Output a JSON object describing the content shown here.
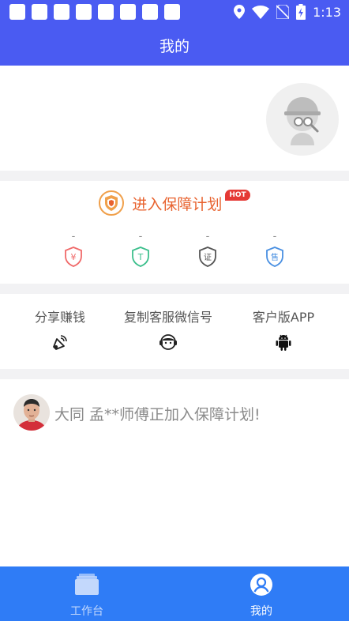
{
  "status_bar": {
    "notification_icons": [
      "notification-icon",
      "notification-icon",
      "notification-icon",
      "notification-icon",
      "notification-icon",
      "notification-icon",
      "notification-icon",
      "notification-icon"
    ],
    "system_icons": [
      "location-icon",
      "wifi-icon",
      "no-sim-icon",
      "battery-charging-icon"
    ],
    "time": "1:13"
  },
  "header": {
    "title": "我的"
  },
  "guarantee": {
    "label": "进入保障计划",
    "hot_badge": "HOT",
    "badges": [
      {
        "value": "-",
        "glyph": "¥",
        "color": "#f06a6a",
        "icon": "yuan-shield-icon"
      },
      {
        "value": "-",
        "glyph": "T",
        "color": "#3cbf8c",
        "icon": "tenge-shield-icon"
      },
      {
        "value": "-",
        "glyph": "证",
        "color": "#555555",
        "icon": "certificate-shield-icon"
      },
      {
        "value": "-",
        "glyph": "售",
        "color": "#4a90e2",
        "icon": "after-sales-shield-icon"
      }
    ]
  },
  "actions": [
    {
      "label": "分享赚钱",
      "icon": "share-icon"
    },
    {
      "label": "复制客服微信号",
      "icon": "customer-service-icon"
    },
    {
      "label": "客户版APP",
      "icon": "android-icon"
    }
  ],
  "notice": {
    "text": "大同 孟**师傅正加入保障计划!"
  },
  "bottom_nav": [
    {
      "label": "工作台",
      "icon": "workbench-icon"
    },
    {
      "label": "我的",
      "icon": "profile-icon"
    }
  ],
  "colors": {
    "header": "#4a5bf2",
    "nav": "#2f7cf6",
    "accent": "#e8622e"
  }
}
